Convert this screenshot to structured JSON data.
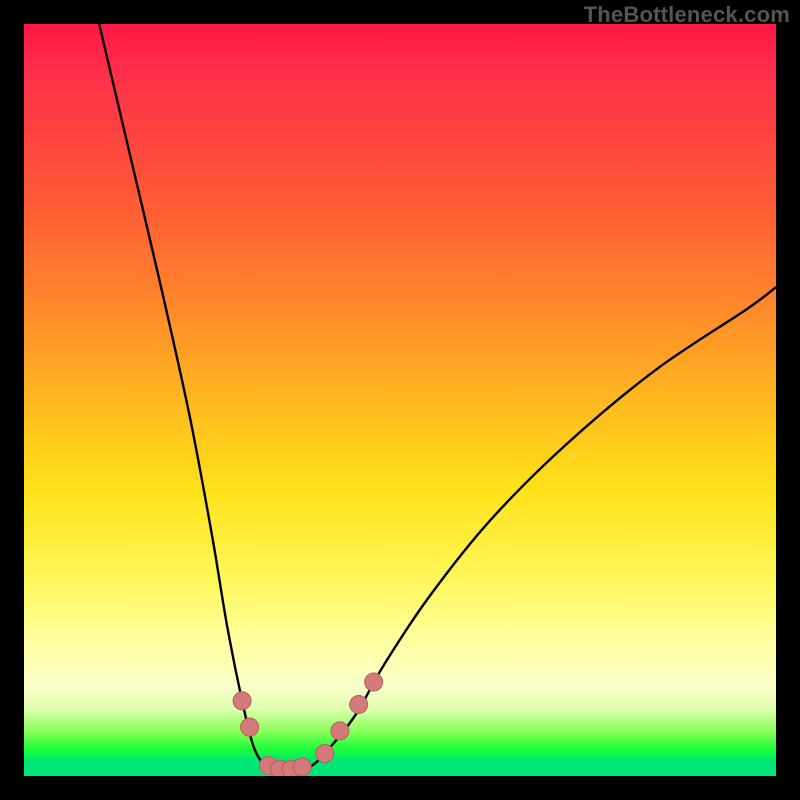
{
  "watermark": "TheBottleneck.com",
  "chart_data": {
    "type": "line",
    "title": "",
    "xlabel": "",
    "ylabel": "",
    "xlim": [
      0,
      100
    ],
    "ylim": [
      0,
      100
    ],
    "grid": false,
    "legend": false,
    "series": [
      {
        "name": "bottleneck-curve",
        "x": [
          10,
          14,
          18,
          22,
          25,
          27,
          29,
          30.5,
          32,
          34,
          36,
          38,
          40,
          44,
          48,
          54,
          62,
          72,
          84,
          96,
          100
        ],
        "y": [
          100,
          83,
          66,
          48,
          32,
          20,
          10,
          4,
          1.5,
          0.5,
          0.5,
          1.2,
          3,
          8,
          15,
          24,
          34,
          44,
          54,
          62,
          65
        ]
      }
    ],
    "markers": [
      {
        "name": "left-arm-marker-1",
        "x": 29.0,
        "y": 10.0
      },
      {
        "name": "left-arm-marker-2",
        "x": 30.0,
        "y": 6.5
      },
      {
        "name": "trough-marker-1",
        "x": 32.5,
        "y": 1.4
      },
      {
        "name": "trough-marker-2",
        "x": 34.0,
        "y": 0.9
      },
      {
        "name": "trough-marker-3",
        "x": 35.5,
        "y": 0.9
      },
      {
        "name": "trough-marker-4",
        "x": 37.0,
        "y": 1.2
      },
      {
        "name": "right-arm-marker-1",
        "x": 40.0,
        "y": 3.0
      },
      {
        "name": "right-arm-marker-2",
        "x": 42.0,
        "y": 6.0
      },
      {
        "name": "right-arm-marker-3",
        "x": 44.5,
        "y": 9.5
      },
      {
        "name": "right-arm-marker-4",
        "x": 46.5,
        "y": 12.5
      }
    ],
    "marker_style": {
      "radius_px": 9,
      "fill": "#d47a7a",
      "stroke": "#b85c5c"
    },
    "background_gradient": {
      "type": "vertical",
      "stops": [
        {
          "pos": 0.0,
          "color": "#ff1744"
        },
        {
          "pos": 0.22,
          "color": "#ff5538"
        },
        {
          "pos": 0.5,
          "color": "#ffb81f"
        },
        {
          "pos": 0.74,
          "color": "#fff85c"
        },
        {
          "pos": 0.88,
          "color": "#fbffca"
        },
        {
          "pos": 0.96,
          "color": "#1aff3a"
        },
        {
          "pos": 1.0,
          "color": "#00e676"
        }
      ]
    }
  }
}
